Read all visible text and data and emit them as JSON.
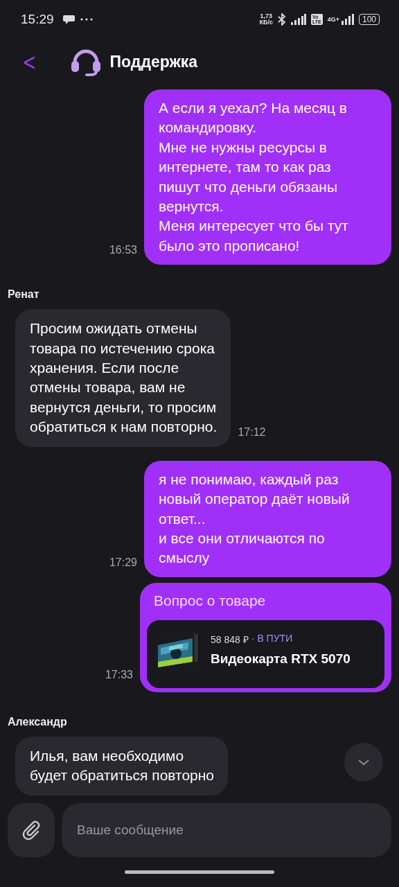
{
  "status_bar": {
    "time": "15:29",
    "speed": "1,73\nКБ/с",
    "volte": "Vo\nLTE",
    "network": "4G+",
    "battery": "100"
  },
  "header": {
    "back": "<",
    "title": "Поддержка"
  },
  "messages": [
    {
      "kind": "outgoing",
      "text": "А если я уехал? На месяц в\nкомандировку.\nМне не нужны ресурсы в\nинтернете, там то как раз\nпишут что деньги обязаны\nвернутся.\nМеня интересует что бы тут\nбыло это прописано!",
      "time": "16:53"
    },
    {
      "kind": "incoming",
      "sender": "Ренат",
      "text": "Просим ожидать отмены\nтовара по истечению срока\nхранения. Если после\nотмены товара, вам не\nвернутся деньги, то просим\nобратиться к нам повторно.",
      "time": "17:12"
    },
    {
      "kind": "outgoing",
      "text": "я не понимаю, каждый раз\nновый оператор даёт новый\nответ...\nи все они отличаются по\nсмыслу",
      "time": "17:29"
    },
    {
      "kind": "product",
      "title": "Вопрос о товаре",
      "price": "58 848 ₽",
      "separator": "·",
      "status": "В ПУТИ",
      "name": "Видеокарта RTX 5070",
      "time": "17:33"
    },
    {
      "kind": "incoming",
      "sender": "Александр",
      "text": "Илья, вам необходимо\nбудет обратиться повторно"
    }
  ],
  "composer": {
    "placeholder": "Ваше сообщение"
  }
}
